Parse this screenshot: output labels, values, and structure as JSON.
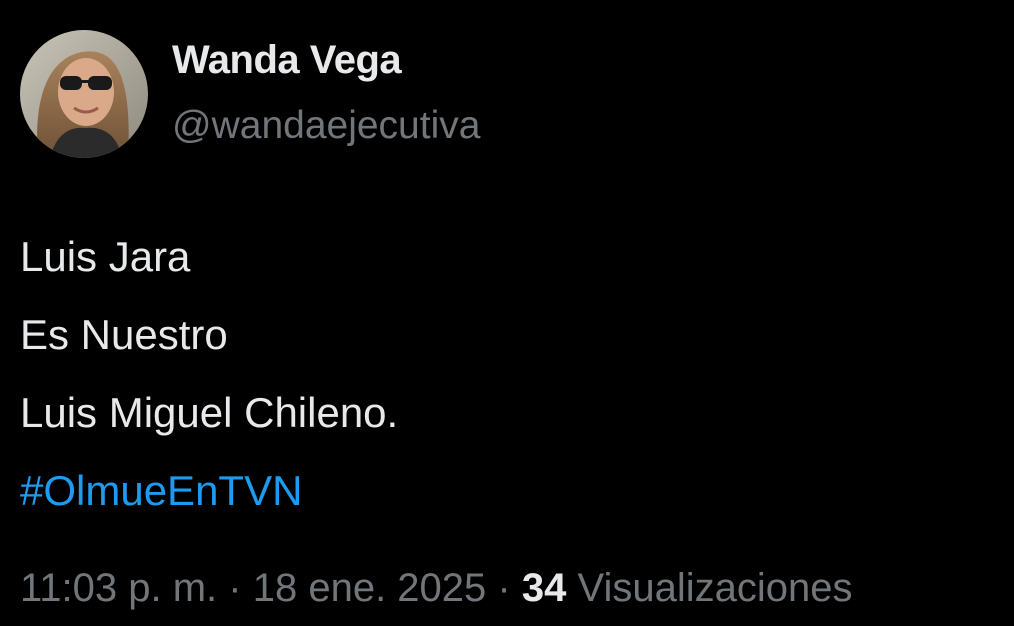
{
  "author": {
    "display_name": "Wanda Vega",
    "handle": "@wandaejecutiva",
    "avatar_icon": "user-avatar-photo"
  },
  "tweet": {
    "lines": [
      "Luis Jara",
      "Es Nuestro",
      "Luis Miguel Chileno."
    ],
    "hashtag": "#OlmueEnTVN"
  },
  "meta": {
    "time": "11:03 p. m.",
    "separator": "·",
    "date": "18 ene. 2025",
    "views_count": "34",
    "views_label": "Visualizaciones"
  },
  "colors": {
    "background": "#000000",
    "text_primary": "#e7e9ea",
    "text_secondary": "#71767b",
    "link": "#1d9bf0"
  }
}
